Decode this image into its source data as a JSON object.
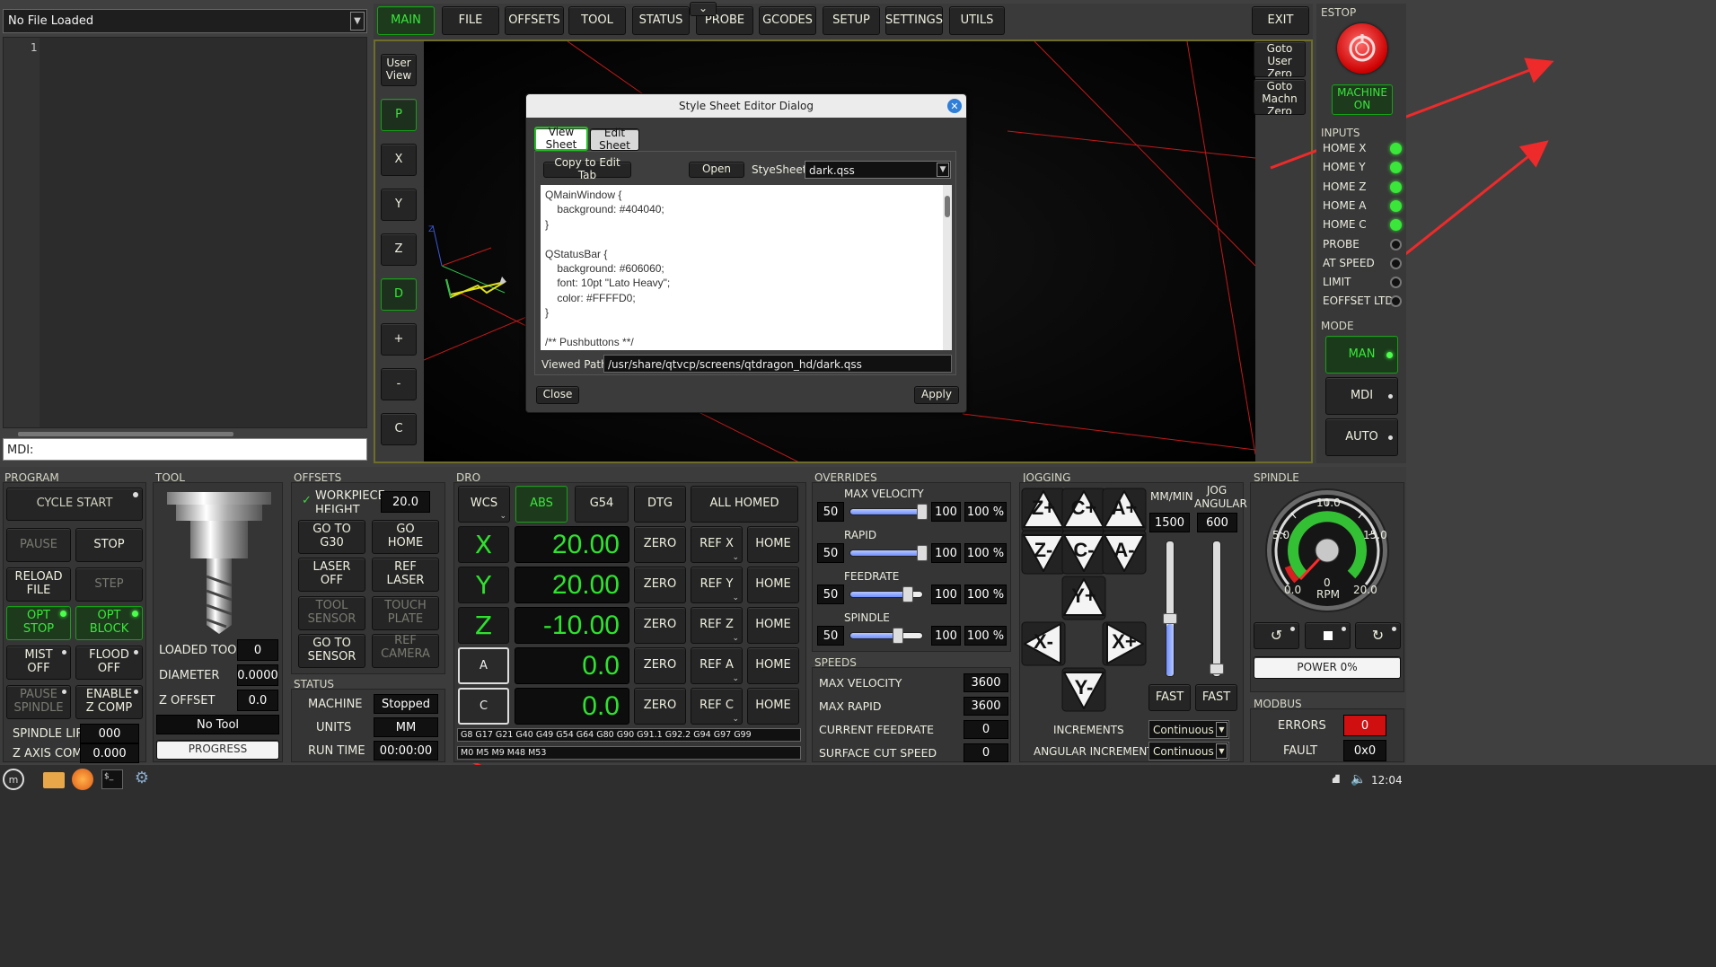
{
  "file_bar": {
    "label": "No File Loaded"
  },
  "editor": {
    "line_number": "1"
  },
  "mdi": {
    "label": "MDI:"
  },
  "tabs": [
    "MAIN",
    "FILE",
    "OFFSETS",
    "TOOL",
    "STATUS",
    "PROBE",
    "GCODES",
    "SETUP",
    "SETTINGS",
    "UTILS"
  ],
  "exit_label": "EXIT",
  "estop": {
    "title": "ESTOP",
    "machine_on": "MACHINE\nON"
  },
  "inputs": {
    "title": "INPUTS",
    "items": [
      {
        "label": "HOME X",
        "state": "on"
      },
      {
        "label": "HOME Y",
        "state": "on"
      },
      {
        "label": "HOME Z",
        "state": "on"
      },
      {
        "label": "HOME A",
        "state": "on"
      },
      {
        "label": "HOME C",
        "state": "on"
      },
      {
        "label": "PROBE",
        "state": "off"
      },
      {
        "label": "AT SPEED",
        "state": "off"
      },
      {
        "label": "LIMIT",
        "state": "off"
      },
      {
        "label": "EOFFSET LTD",
        "state": "off"
      }
    ]
  },
  "mode": {
    "title": "MODE",
    "man": "MAN",
    "mdi": "MDI",
    "auto": "AUTO"
  },
  "view_buttons": [
    "User\nView",
    "P",
    "X",
    "Y",
    "Z",
    "D",
    "+",
    "-",
    "C"
  ],
  "goto": {
    "user": "Goto\nUser\nZero",
    "machine": "Goto\nMachn\nZero"
  },
  "dialog": {
    "title": "Style Sheet Editor Dialog",
    "tab_view": "View Sheet",
    "tab_edit": "Edit Sheet",
    "copy": "Copy to Edit Tab",
    "open": "Open",
    "stylesheet_label": "StyeSheet:",
    "stylesheet_value": "dark.qss",
    "lines": [
      "QMainWindow {",
      "    background: #404040;",
      "}",
      "",
      "QStatusBar {",
      "    background: #606060;",
      "    font: 10pt \"Lato Heavy\";",
      "    color: #FFFFD0;",
      "}",
      "",
      "/** Pushbuttons **/"
    ],
    "path_label": "Viewed Path:",
    "path_value": "/usr/share/qtvcp/screens/qtdragon_hd/dark.qss",
    "close": "Close",
    "apply": "Apply"
  },
  "program": {
    "title": "PROGRAM",
    "cycle_start": "CYCLE START",
    "pause": "PAUSE",
    "stop": "STOP",
    "reload": "RELOAD\nFILE",
    "step": "STEP",
    "opt_stop": "OPT\nSTOP",
    "opt_block": "OPT\nBLOCK",
    "mist": "MIST\nOFF",
    "flood": "FLOOD\nOFF",
    "pause_spindle": "PAUSE\nSPINDLE",
    "enable_zcomp": "ENABLE\nZ COMP",
    "spindle_lift_label": "SPINDLE LIFT",
    "spindle_lift": "000",
    "zaxis_comp_label": "Z AXIS COMP",
    "zaxis_comp": "0.000"
  },
  "tool": {
    "title": "TOOL",
    "loaded_label": "LOADED TOOL",
    "loaded": "0",
    "diameter_label": "DIAMETER",
    "diameter": "0.0000",
    "zoffset_label": "Z OFFSET",
    "zoffset": "0.0",
    "name": "No Tool",
    "progress": "PROGRESS"
  },
  "offsets": {
    "title": "OFFSETS",
    "workpiece_label": "WORKPIECE\nHEIGHT",
    "workpiece": "20.0",
    "goto_g30": "GO TO\nG30",
    "go_home": "GO\nHOME",
    "laser_off": "LASER\nOFF",
    "ref_laser": "REF\nLASER",
    "tool_sensor": "TOOL\nSENSOR",
    "touch_plate": "TOUCH\nPLATE",
    "goto_sensor": "GO TO\nSENSOR",
    "ref_camera": "REF\nCAMERA"
  },
  "status": {
    "title": "STATUS",
    "machine_label": "MACHINE",
    "machine": "Stopped",
    "units_label": "UNITS",
    "units": "MM",
    "runtime_label": "RUN TIME",
    "runtime": "00:00:00"
  },
  "dro": {
    "title": "DRO",
    "wcs": "WCS",
    "abs": "ABS",
    "g54": "G54",
    "dtg": "DTG",
    "all_homed": "ALL HOMED",
    "axes": [
      {
        "axis": "X",
        "value": "20.00",
        "ref": "REF X"
      },
      {
        "axis": "Y",
        "value": "20.00",
        "ref": "REF Y"
      },
      {
        "axis": "Z",
        "value": "-10.00",
        "ref": "REF Z"
      },
      {
        "axis": "A",
        "value": "0.0",
        "ref": "REF A"
      },
      {
        "axis": "C",
        "value": "0.0",
        "ref": "REF C"
      }
    ],
    "zero": "ZERO",
    "home": "HOME",
    "gcodes": "G8 G17 G21 G40 G49 G54 G64 G80 G90 G91.1 G92.2 G94 G97 G99",
    "mcodes": "M0 M5 M9 M48 M53"
  },
  "overrides": {
    "title": "OVERRIDES",
    "rows": [
      {
        "label": "MAX VELOCITY",
        "min": "50",
        "max": "100",
        "pct": "100 %",
        "fraction": 1.0
      },
      {
        "label": "RAPID",
        "min": "50",
        "max": "100",
        "pct": "100 %",
        "fraction": 1.0
      },
      {
        "label": "FEEDRATE",
        "min": "50",
        "max": "100",
        "pct": "100 %",
        "fraction": 0.8
      },
      {
        "label": "SPINDLE",
        "min": "50",
        "max": "100",
        "pct": "100 %",
        "fraction": 0.67
      }
    ]
  },
  "speeds": {
    "title": "SPEEDS",
    "rows": [
      {
        "label": "MAX VELOCITY",
        "value": "3600"
      },
      {
        "label": "MAX RAPID",
        "value": "3600"
      },
      {
        "label": "CURRENT FEEDRATE",
        "value": "0"
      },
      {
        "label": "SURFACE CUT SPEED",
        "value": "0"
      }
    ]
  },
  "jogging": {
    "title": "JOGGING",
    "mm_min": "MM/MIN",
    "jog_angular": "JOG\nANGULAR",
    "linear": "1500",
    "angular": "600",
    "fast": "FAST",
    "increments_label": "INCREMENTS",
    "increments": "Continuous",
    "angular_inc_label": "ANGULAR INCREMENT",
    "angular_inc": "Continuous",
    "keys": [
      "Z+",
      "C+",
      "A+",
      "Z-",
      "C-",
      "A-",
      "Y+",
      "X-",
      "X+",
      "Y-"
    ]
  },
  "spindle": {
    "title": "SPINDLE",
    "gauge_labels": [
      "10.0",
      "5.0",
      "15.0",
      "0.0",
      "20.0"
    ],
    "rpm_value": "0",
    "rpm_label": "RPM",
    "power": "POWER 0%"
  },
  "modbus": {
    "title": "MODBUS",
    "errors_label": "ERRORS",
    "errors": "0",
    "fault_label": "FAULT",
    "fault": "0x0"
  },
  "taskbar": {
    "time": "12:04"
  }
}
